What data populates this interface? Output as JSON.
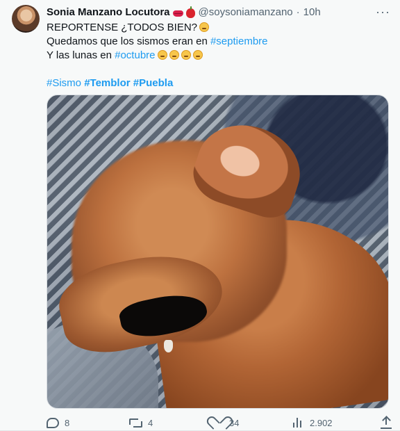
{
  "author": {
    "display_name": "Sonia Manzano Locutora",
    "name_emojis": [
      "lips-emoji",
      "apple-emoji"
    ],
    "handle": "@soysoniamanzano",
    "separator": "·",
    "time": "10h",
    "more_label": "···"
  },
  "tweet": {
    "line1": "REPORTENSE ¿TODOS BIEN?",
    "line2_prefix": "Quedamos que los sismos eran en ",
    "line2_tag": "#septiembre",
    "line3_prefix": "Y las lunas en ",
    "line3_tag": "#octubre",
    "hashtags": [
      "#Sismo",
      "#Temblor",
      "#Puebla"
    ],
    "emojis": [
      "worried-face-emoji",
      "weary-face-emoji",
      "tired-face-emoji",
      "confounded-face-emoji",
      "persevering-face-emoji"
    ]
  },
  "media": {
    "image_icon": "dog-yawning-photo"
  },
  "actions": {
    "reply_count": "8",
    "retweet_count": "4",
    "like_count": "34",
    "view_count": "2.902"
  },
  "colors": {
    "link": "#1d9bf0",
    "secondary_text": "#536471",
    "background": "#f7f9f9"
  }
}
